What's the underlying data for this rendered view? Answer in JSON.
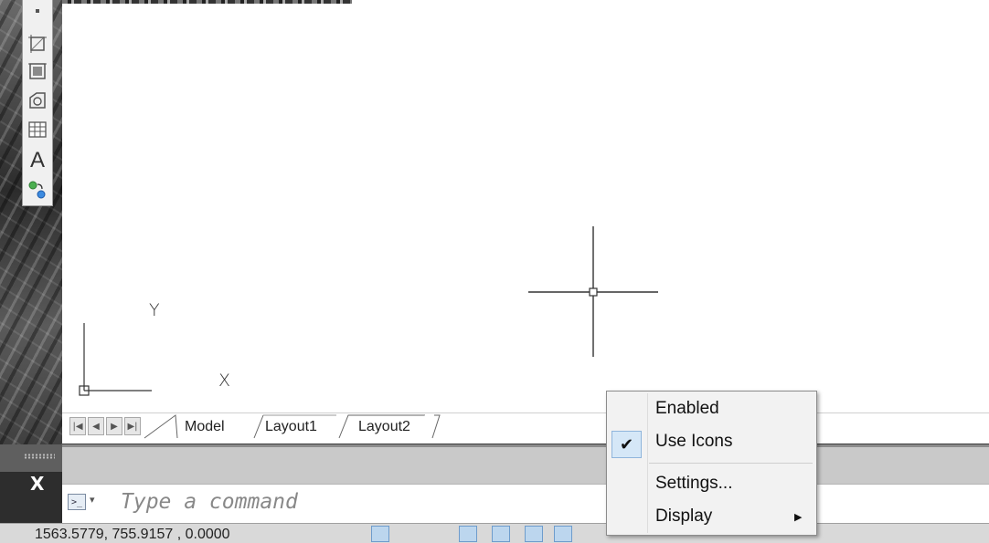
{
  "toolbar": {
    "icons": [
      "point-icon",
      "region-icon",
      "wipeout-icon",
      "revision-cloud-icon",
      "table-icon",
      "text-icon",
      "add-selected-icon"
    ],
    "text_glyph": "A"
  },
  "canvas": {
    "ucs_x_label": "X",
    "ucs_y_label": "Y",
    "background": "#ffffff"
  },
  "tabs": {
    "nav": [
      "|◀",
      "◀",
      "▶",
      "▶|"
    ],
    "items": [
      "Model",
      "Layout1",
      "Layout2"
    ],
    "active": "Model"
  },
  "command": {
    "placeholder": "Type a command",
    "close_glyph": "X"
  },
  "status": {
    "coordinates": "1563.5779, 755.9157 , 0.0000"
  },
  "context_menu": {
    "items": [
      {
        "label": "Enabled",
        "checked": false
      },
      {
        "label": "Use Icons",
        "checked": true
      },
      {
        "label": "Settings...",
        "checked": false
      },
      {
        "label": "Display",
        "checked": false,
        "submenu": true
      }
    ],
    "check_glyph": "✔",
    "submenu_glyph": "▶"
  },
  "colors": {
    "accent": "#bcd6ee",
    "check_highlight": "#d5e7f7"
  }
}
